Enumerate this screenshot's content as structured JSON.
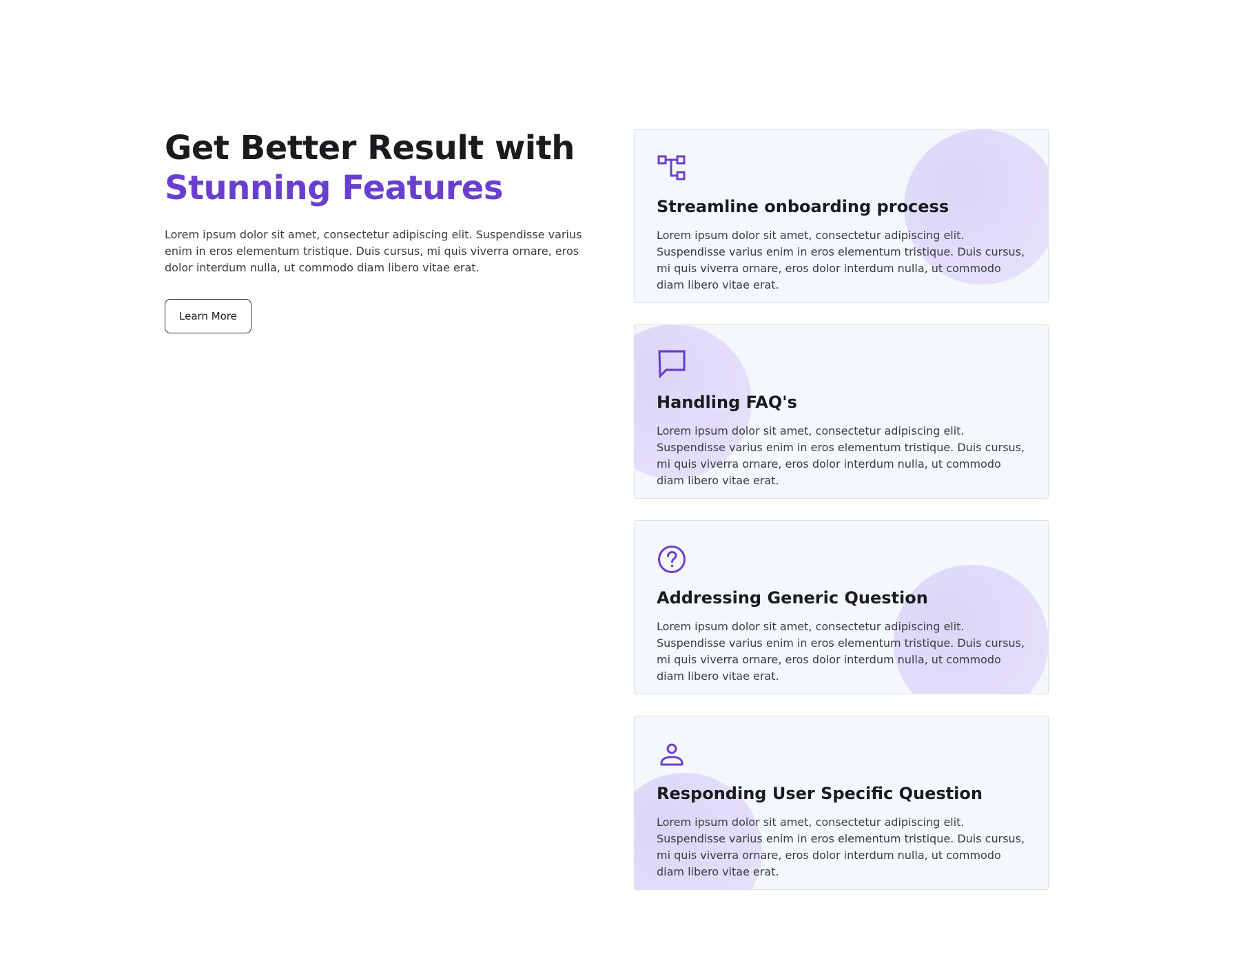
{
  "hero": {
    "title_line1": "Get Better Result with",
    "title_line2": "Stunning Features",
    "description": "Lorem ipsum dolor sit amet, consectetur adipiscing elit. Suspendisse varius enim in eros elementum tristique. Duis cursus, mi quis viverra ornare, eros dolor interdum nulla, ut commodo diam libero vitae erat.",
    "button_label": "Learn More"
  },
  "colors": {
    "accent": "#6a3fcf",
    "card_background": "#f4f7fb",
    "blob": "#e4ddfa",
    "text_dark": "#1b1b1f"
  },
  "features": [
    {
      "icon": "workflow-icon",
      "title": "Streamline onboarding process",
      "description": "Lorem ipsum dolor sit amet, consectetur adipiscing elit. Suspendisse varius enim in eros elementum tristique. Duis cursus, mi quis viverra ornare, eros dolor interdum nulla, ut commodo diam libero vitae erat."
    },
    {
      "icon": "chat-bubble-icon",
      "title": "Handling FAQ's",
      "description": "Lorem ipsum dolor sit amet, consectetur adipiscing elit. Suspendisse varius enim in eros elementum tristique. Duis cursus, mi quis viverra ornare, eros dolor interdum nulla, ut commodo diam libero vitae erat."
    },
    {
      "icon": "question-circle-icon",
      "title": "Addressing Generic Question",
      "description": "Lorem ipsum dolor sit amet, consectetur adipiscing elit. Suspendisse varius enim in eros elementum tristique. Duis cursus, mi quis viverra ornare, eros dolor interdum nulla, ut commodo diam libero vitae erat."
    },
    {
      "icon": "user-icon",
      "title": "Responding User Specific Question",
      "description": "Lorem ipsum dolor sit amet, consectetur adipiscing elit. Suspendisse varius enim in eros elementum tristique. Duis cursus, mi quis viverra ornare, eros dolor interdum nulla, ut commodo diam libero vitae erat."
    }
  ]
}
